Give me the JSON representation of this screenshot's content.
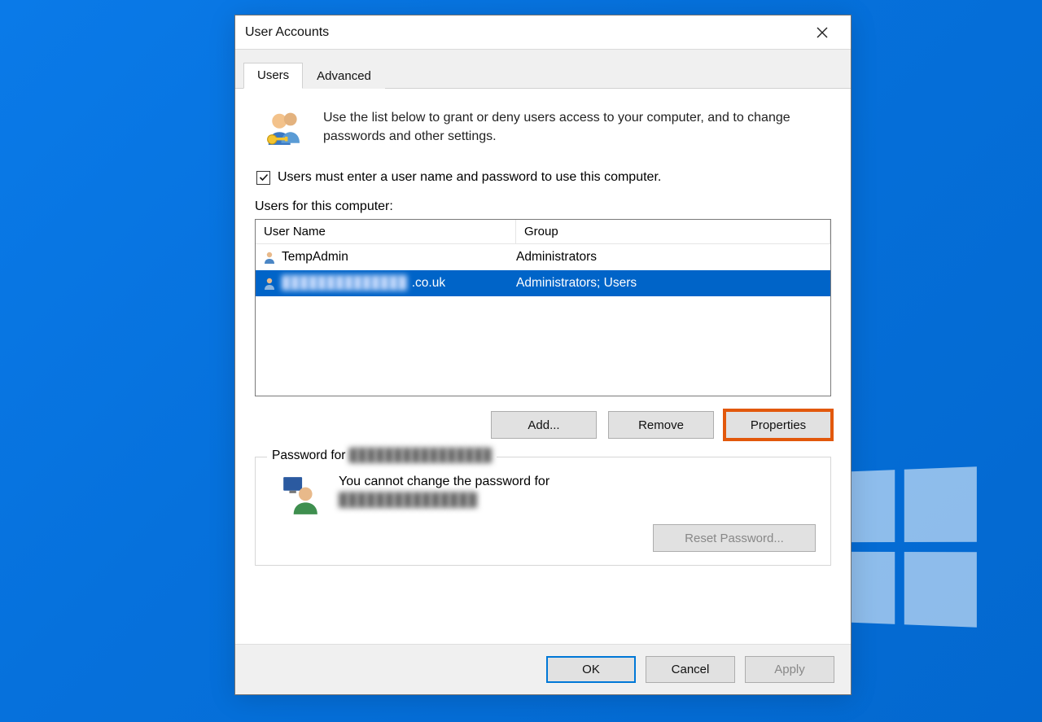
{
  "dialog": {
    "title": "User Accounts",
    "tabs": [
      "Users",
      "Advanced"
    ],
    "active_tab": 0,
    "intro_text": "Use the list below to grant or deny users access to your computer, and to change passwords and other settings.",
    "checkbox_label": "Users must enter a user name and password to use this computer.",
    "checkbox_checked": true,
    "list_label": "Users for this computer:",
    "columns": {
      "username": "User Name",
      "group": "Group"
    },
    "users": [
      {
        "username": "TempAdmin",
        "group": "Administrators",
        "blurred": false,
        "username_suffix": ""
      },
      {
        "username": "██████████████",
        "group": "Administrators; Users",
        "blurred": true,
        "username_suffix": ".co.uk"
      }
    ],
    "selected_index": 1,
    "buttons": {
      "add": "Add...",
      "remove": "Remove",
      "properties": "Properties"
    },
    "password_box": {
      "legend_prefix": "Password for ",
      "legend_user_blurred": "████████████████",
      "cannot_change_text": "You cannot change the password for",
      "cannot_change_user_blurred": "███████████████",
      "reset_button": "Reset Password..."
    },
    "footer": {
      "ok": "OK",
      "cancel": "Cancel",
      "apply": "Apply"
    }
  }
}
